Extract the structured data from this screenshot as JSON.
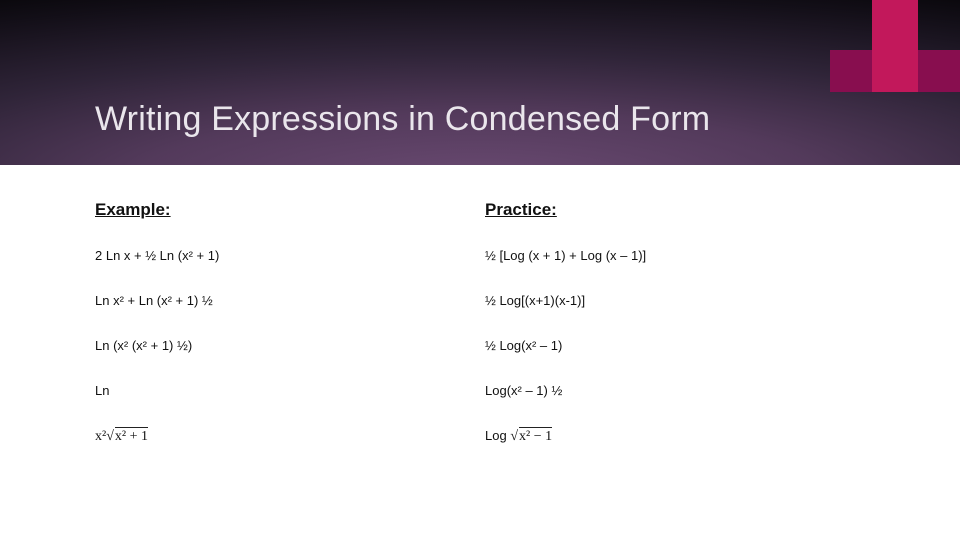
{
  "title": "Writing Expressions in Condensed Form",
  "left": {
    "heading": "Example:",
    "rows": [
      "2 Ln x + ½ Ln (x² + 1)",
      "Ln x² + Ln (x² + 1) ½",
      "Ln (x² (x² + 1) ½)",
      "Ln"
    ],
    "math_prefix": "x²",
    "math_inside": "x² + 1"
  },
  "right": {
    "heading": "Practice:",
    "rows": [
      "½ [Log (x + 1) + Log (x – 1)]",
      "½ Log[(x+1)(x-1)]",
      "½ Log(x² – 1)",
      "Log(x² – 1) ½"
    ],
    "log_prefix": "Log  ",
    "math_inside": "x² − 1"
  }
}
